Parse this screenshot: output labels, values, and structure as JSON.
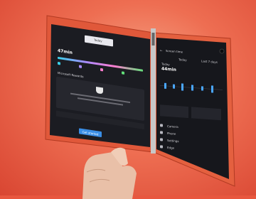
{
  "left_screen": {
    "top_tab": "Today",
    "usage_value": "47min",
    "section_title": "Microsoft Rewards",
    "button_label": "Get started"
  },
  "right_screen": {
    "title": "Screen time",
    "today_label": "Today",
    "today_value": "44min",
    "period_label": "Last 7 days",
    "list_items": [
      "Camera",
      "Phone",
      "Settings",
      "Edge"
    ]
  }
}
